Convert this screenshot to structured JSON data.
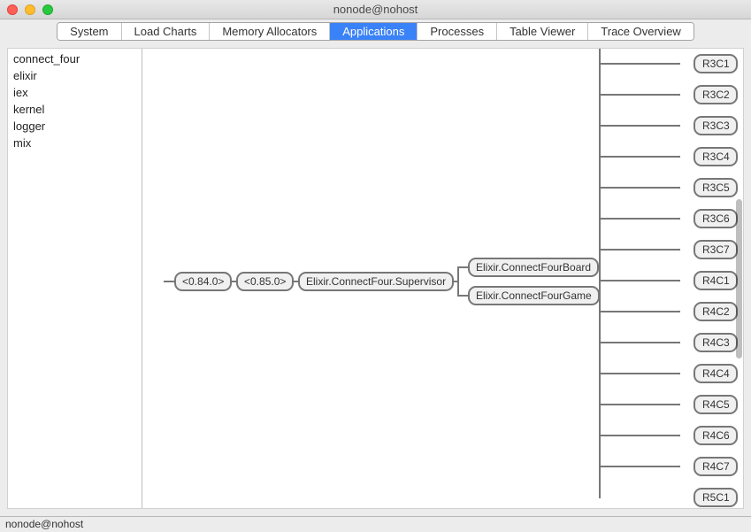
{
  "window": {
    "title": "nonode@nohost"
  },
  "tabs": [
    {
      "label": "System"
    },
    {
      "label": "Load Charts"
    },
    {
      "label": "Memory Allocators"
    },
    {
      "label": "Applications",
      "selected": true
    },
    {
      "label": "Processes"
    },
    {
      "label": "Table Viewer"
    },
    {
      "label": "Trace Overview"
    }
  ],
  "sidebar": {
    "items": [
      {
        "label": "connect_four"
      },
      {
        "label": "elixir"
      },
      {
        "label": "iex"
      },
      {
        "label": "kernel"
      },
      {
        "label": "logger"
      },
      {
        "label": "mix"
      }
    ]
  },
  "tree": {
    "n0": "<0.84.0>",
    "n1": "<0.85.0>",
    "n2": "Elixir.ConnectFour.Supervisor",
    "n3": "Elixir.ConnectFourBoard",
    "n4": "Elixir.ConnectFourGame"
  },
  "rc_nodes": [
    "R3C1",
    "R3C2",
    "R3C3",
    "R3C4",
    "R3C5",
    "R3C6",
    "R3C7",
    "R4C1",
    "R4C2",
    "R4C3",
    "R4C4",
    "R4C5",
    "R4C6",
    "R4C7",
    "R5C1"
  ],
  "status": {
    "text": "nonode@nohost"
  }
}
